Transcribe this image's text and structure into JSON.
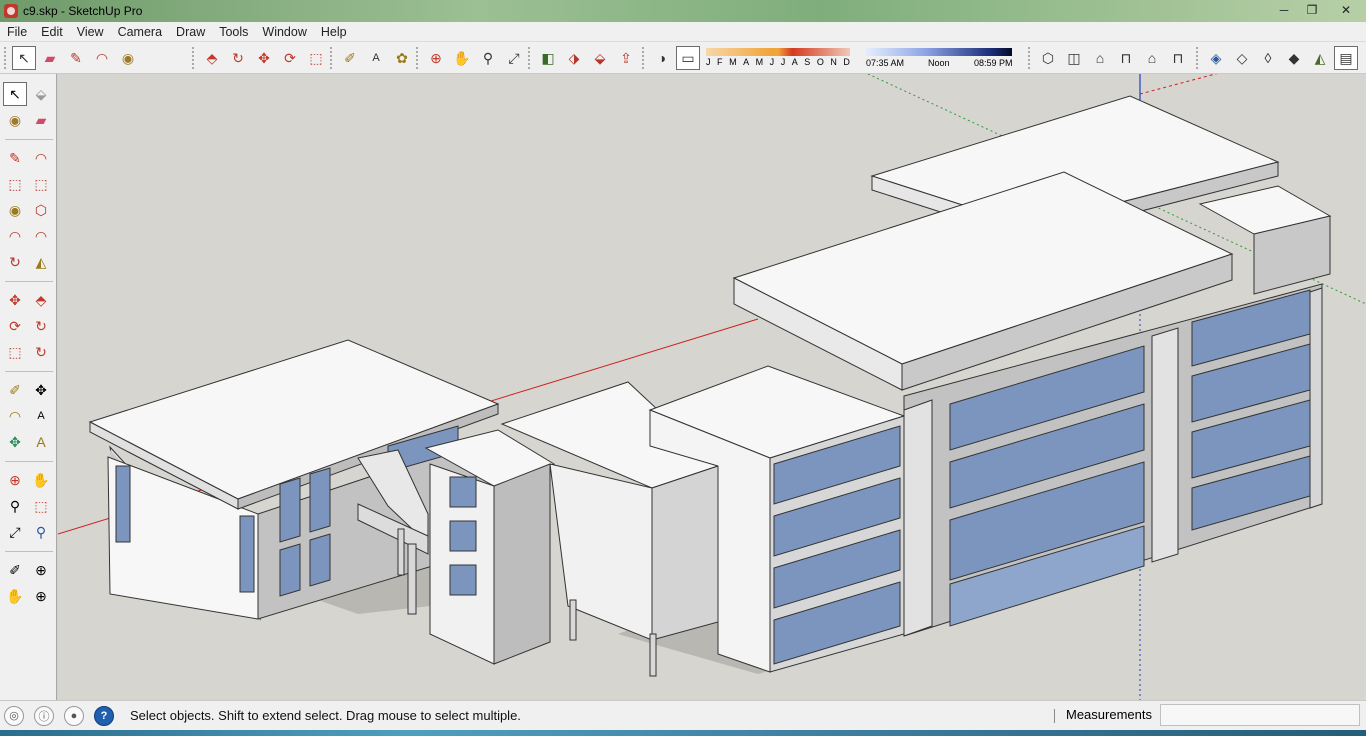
{
  "window": {
    "title": "c9.skp - SketchUp Pro",
    "minimize_label": "─",
    "maximize_label": "❐",
    "close_label": "✕"
  },
  "menu": {
    "items": [
      "File",
      "Edit",
      "View",
      "Camera",
      "Draw",
      "Tools",
      "Window",
      "Help"
    ]
  },
  "shadow_settings": {
    "months": [
      "J",
      "F",
      "M",
      "A",
      "M",
      "J",
      "J",
      "A",
      "S",
      "O",
      "N",
      "D"
    ],
    "time_start": "07:35 AM",
    "time_mid": "Noon",
    "time_end": "08:59 PM"
  },
  "toolbar_icons": {
    "select": "↖",
    "eraser": "▰",
    "pencil": "✎",
    "arc": "◠",
    "paint": "◉",
    "pushpull": "⬘",
    "followme": "↻",
    "move": "✥",
    "rotate": "⟳",
    "scale": "⬚",
    "tape": "✐",
    "text": "A",
    "paint2": "✿",
    "orbit": "⊕",
    "pan": "✋",
    "zoom": "⚲",
    "zoomext": "⤢",
    "prev": "◧",
    "warehouse": "⬗",
    "components": "⬙",
    "export": "⇪",
    "shadows": "◑",
    "fog": "▭",
    "iso": "⬡",
    "top": "◫",
    "front": "⌂",
    "right": "⊓",
    "back": "⌂",
    "left": "⊓",
    "xray": "◈",
    "wire": "◇",
    "hidden": "◊",
    "shaded": "◆",
    "textured": "◭",
    "mono": "▤"
  },
  "status": {
    "message": "Select objects. Shift to extend select. Drag mouse to select multiple.",
    "measurements_label": "Measurements"
  },
  "colors": {
    "accent_red_axis": "#cc1f1f",
    "accent_green_axis": "#2e9a3a",
    "accent_blue_axis": "#1f3fbf",
    "glass": "#7c95be",
    "wall": "#f6f6f6",
    "wall_shade": "#bdbdbd"
  }
}
